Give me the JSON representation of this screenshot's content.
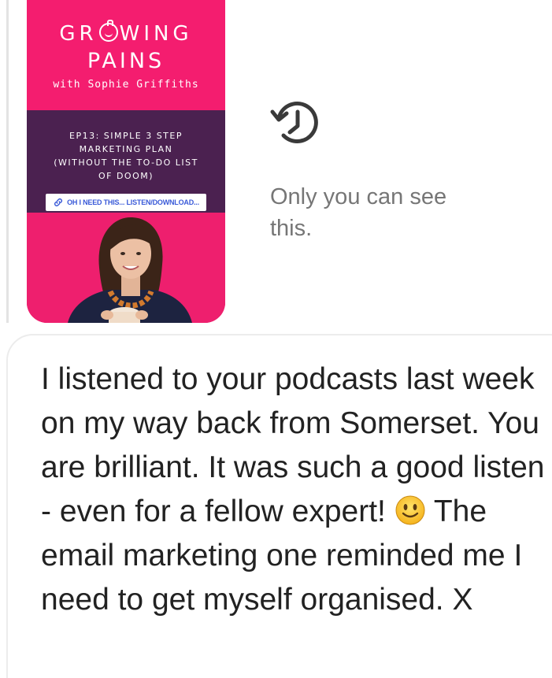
{
  "story": {
    "brand_top": "GR",
    "brand_top_rest": "WING",
    "brand_middle": "PAINS",
    "brand_byline": "with Sophie Griffiths",
    "episode_title": "EP13: SIMPLE 3 STEP\nMARKETING PLAN\n(WITHOUT THE TO-DO LIST\nOF DOOM)",
    "link_label": "OH I NEED THIS... LISTEN/DOWNLOAD...",
    "link_icon": "link-icon",
    "colors": {
      "pink": "#f41d6f",
      "plum": "#4b2150"
    }
  },
  "visibility": {
    "icon": "history-icon",
    "text": "Only you can see this."
  },
  "message": {
    "text_before_emoji": "I listened to your podcasts last week on my way back from Somerset. You are brilliant. It was such a good listen - even for a fellow expert!",
    "emoji": "slightly-smiling-face-emoji",
    "text_after_emoji": "The email marketing one reminded me I need to get myself organised. X"
  }
}
